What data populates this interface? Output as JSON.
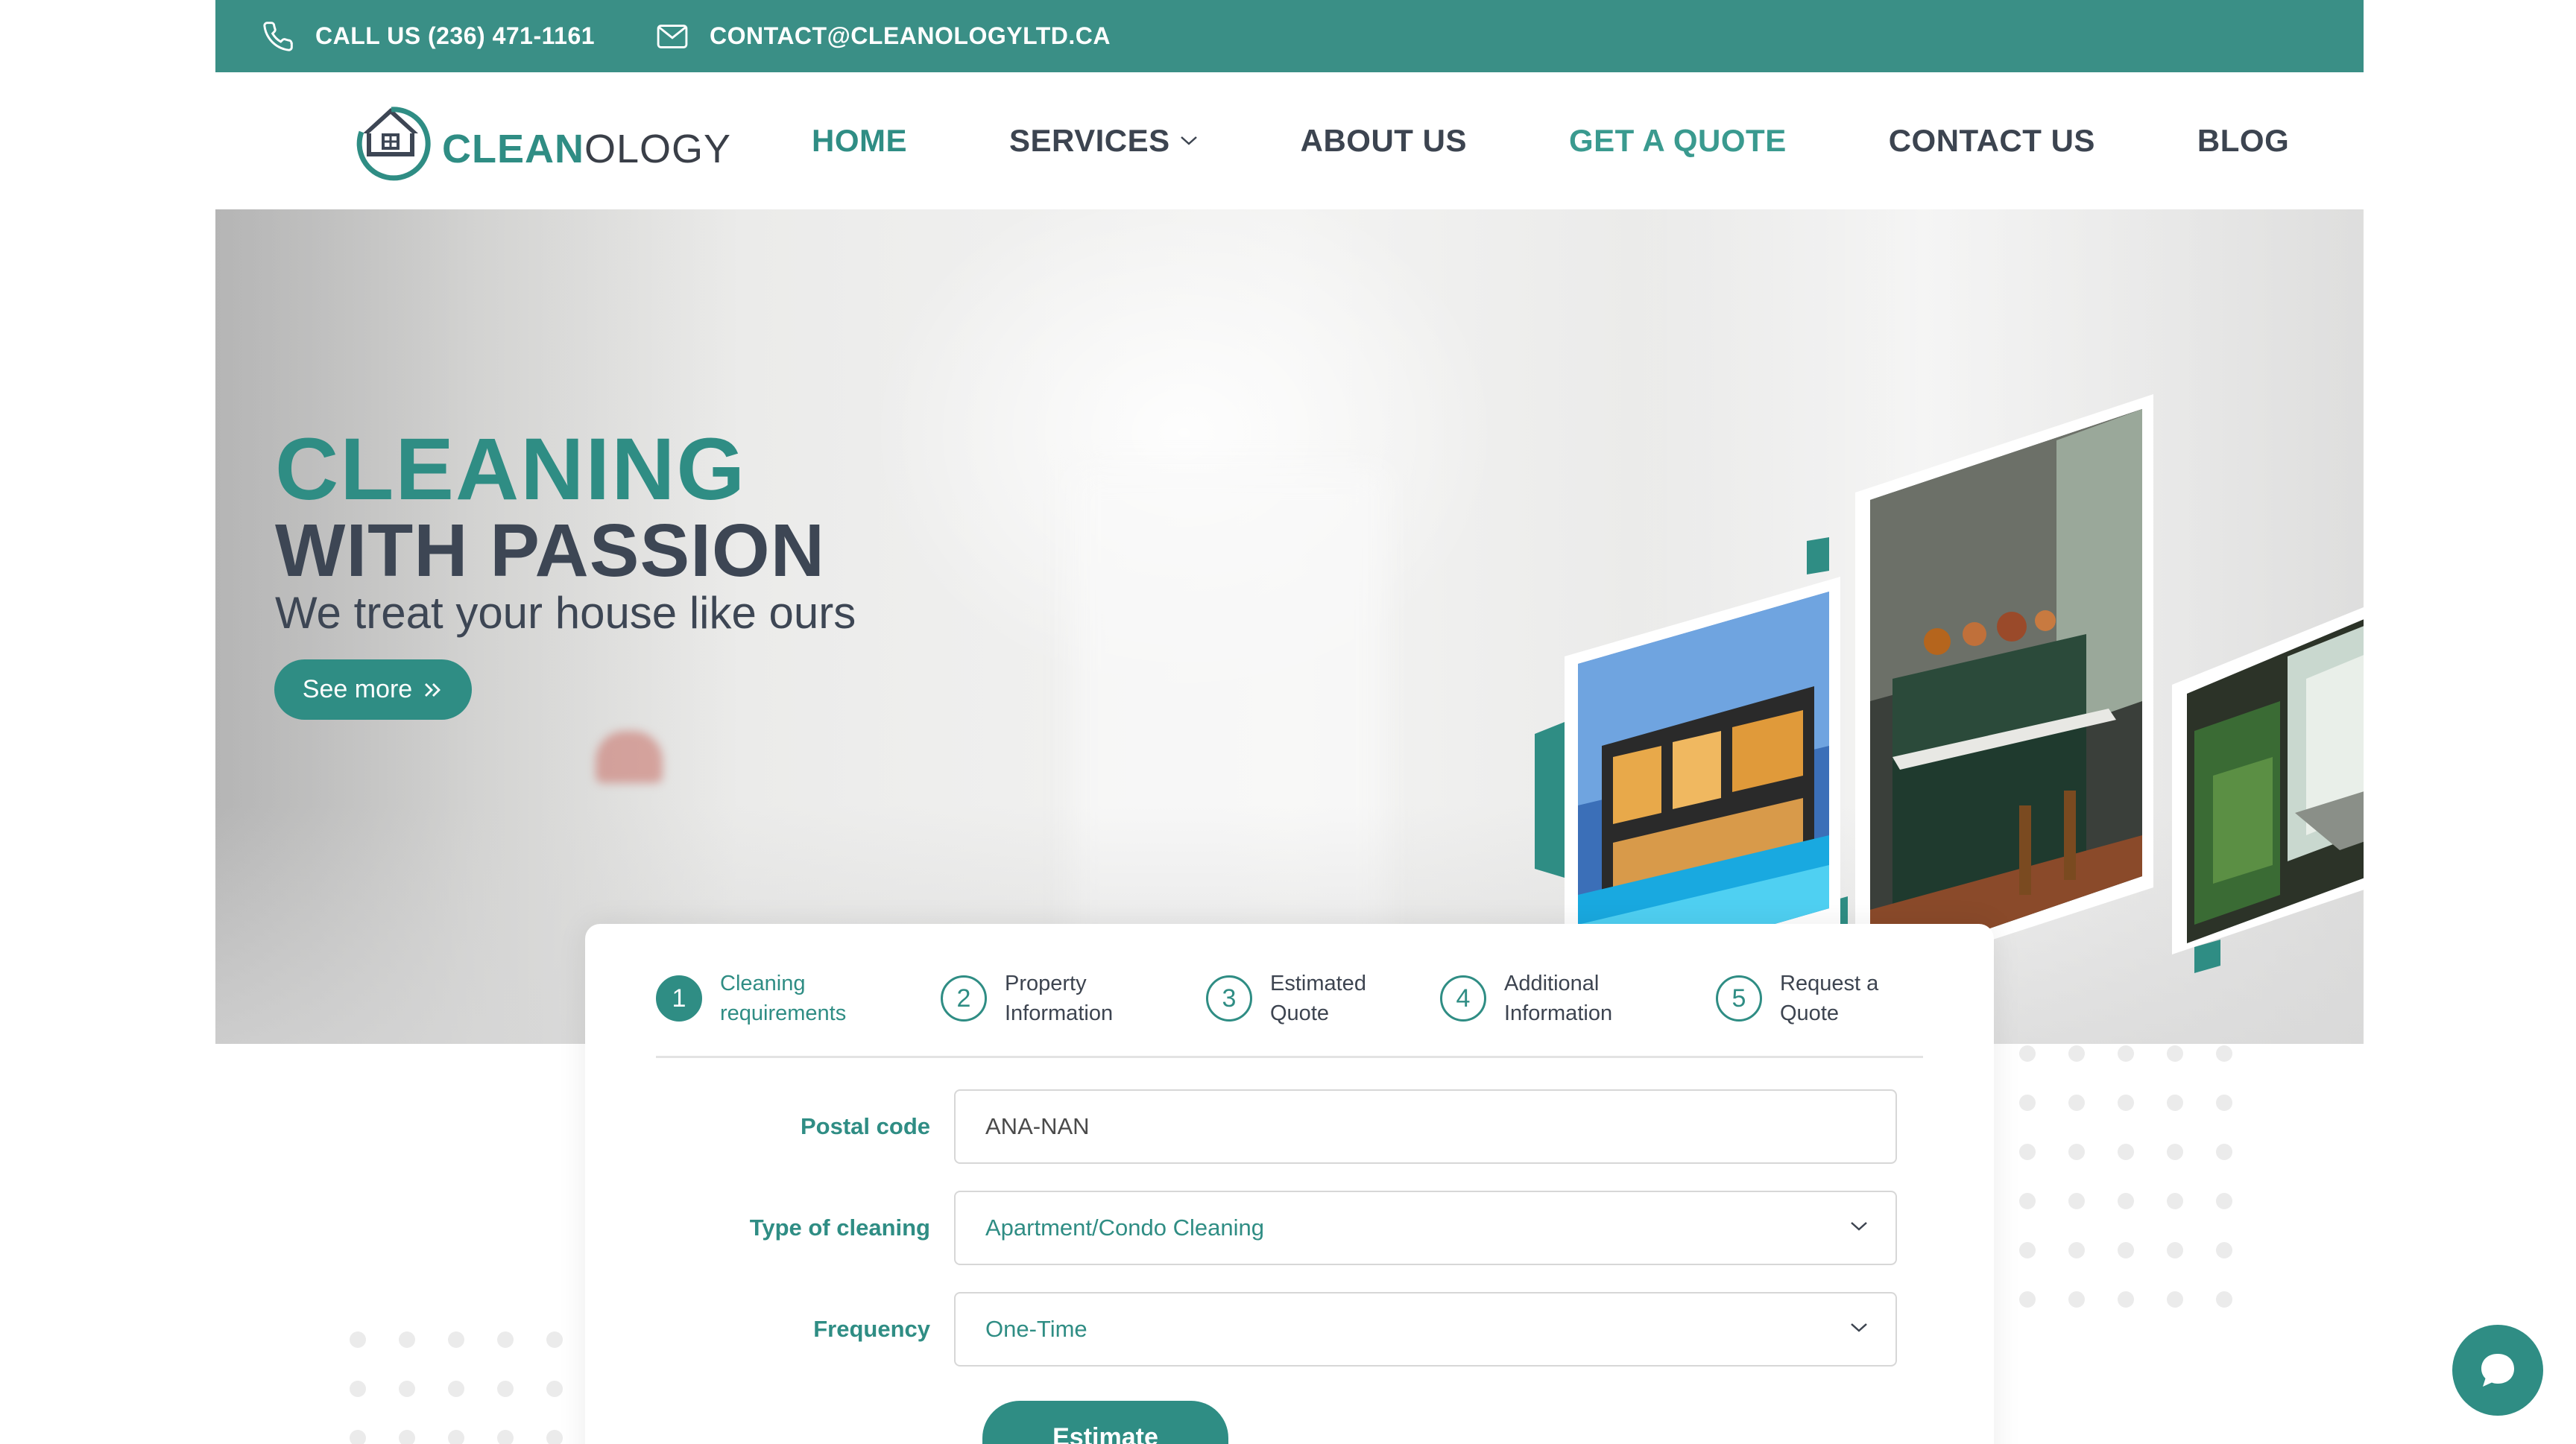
{
  "topbar": {
    "phone_label": "CALL US (236) 471-1161",
    "email_label": "CONTACT@CLEANOLOGYLTD.CA"
  },
  "logo": {
    "text_a": "CLEAN",
    "text_b": "OLOGY"
  },
  "nav": {
    "items": [
      {
        "label": "HOME",
        "active": true
      },
      {
        "label": "SERVICES",
        "has_dropdown": true
      },
      {
        "label": "ABOUT US"
      },
      {
        "label": "GET A QUOTE"
      },
      {
        "label": "CONTACT US"
      },
      {
        "label": "BLOG"
      }
    ]
  },
  "hero": {
    "line1": "CLEANING",
    "line2": "WITH PASSION",
    "line3": "We treat your house like ours",
    "cta": "See more"
  },
  "quote_form": {
    "steps": [
      {
        "num": "1",
        "label": "Cleaning requirements",
        "active": true
      },
      {
        "num": "2",
        "label": "Property Information"
      },
      {
        "num": "3",
        "label": "Estimated Quote"
      },
      {
        "num": "4",
        "label": "Additional Information"
      },
      {
        "num": "5",
        "label": "Request a Quote"
      }
    ],
    "postal_label": "Postal code",
    "postal_value": "ANA-NAN",
    "type_label": "Type of cleaning",
    "type_value": "Apartment/Condo Cleaning",
    "frequency_label": "Frequency",
    "frequency_value": "One-Time",
    "estimate_button": "Estimate"
  },
  "colors": {
    "brand": "#2f8d84",
    "topbar": "#3a8f86",
    "dark_text": "#3d4654"
  },
  "icons": {
    "phone": "phone-icon",
    "email": "mail-icon",
    "chat": "chat-icon"
  }
}
